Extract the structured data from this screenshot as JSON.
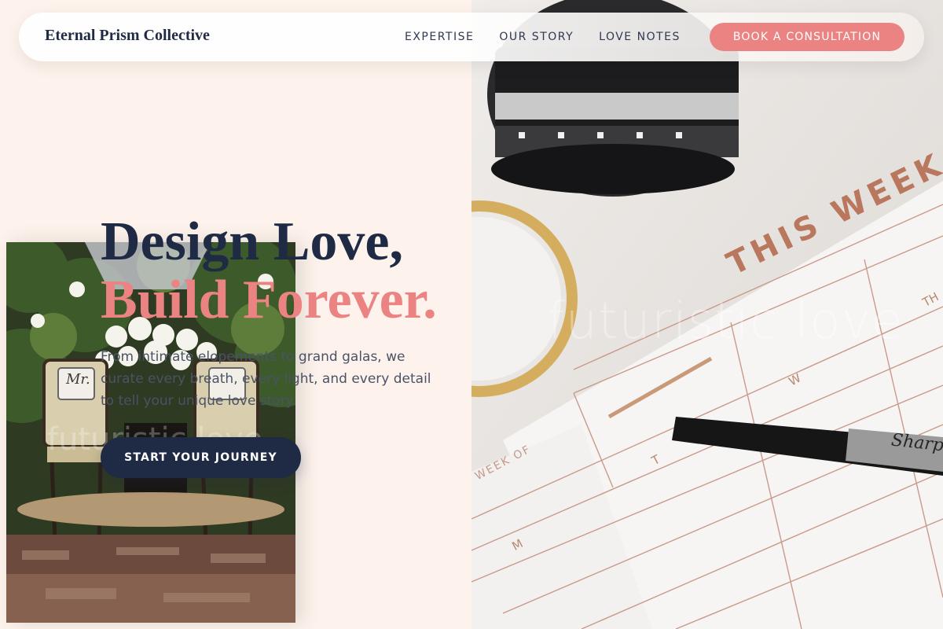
{
  "nav": {
    "brand": "Eternal Prism Collective",
    "links": [
      "EXPERTISE",
      "OUR STORY",
      "LOVE NOTES"
    ],
    "cta": "BOOK A CONSULTATION"
  },
  "hero": {
    "title_line1": "Design Love,",
    "title_line2": "Build Forever.",
    "body": "From intimate elopements to grand galas, we curate every breath, every light, and every detail to tell your unique love story.",
    "cta": "START YOUR JOURNEY"
  },
  "images": {
    "left_photo": "wedding-chairs-photo",
    "right_photo": "planner-camera-flatlay-photo",
    "watermark": "futuristic love",
    "chair_sign": "Mr.",
    "planner_heading": "THIS WEEK",
    "planner_label": "WEEK OF",
    "planner_days": [
      "M",
      "T",
      "W",
      "TH"
    ],
    "pen_brand": "Sharpie"
  },
  "colors": {
    "navy": "#1f2a44",
    "coral": "#ec8383",
    "cream": "#fdf3ec"
  }
}
